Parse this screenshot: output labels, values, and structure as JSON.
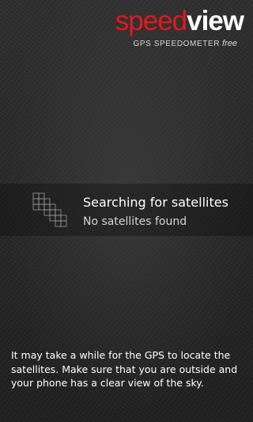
{
  "header": {
    "logo_part1": "speed",
    "logo_part2": "view",
    "tagline": "GPS SPEEDOMETER",
    "tagline_free": "free",
    "brand_red": "#e3181d"
  },
  "status": {
    "icon": "satellite-grid-icon",
    "title": "Searching for satellites",
    "subtitle": "No satellites found"
  },
  "hint": {
    "text": "It may take a while for the GPS to locate the satellites. Make sure that you are outside and your phone has a clear view of the sky."
  }
}
